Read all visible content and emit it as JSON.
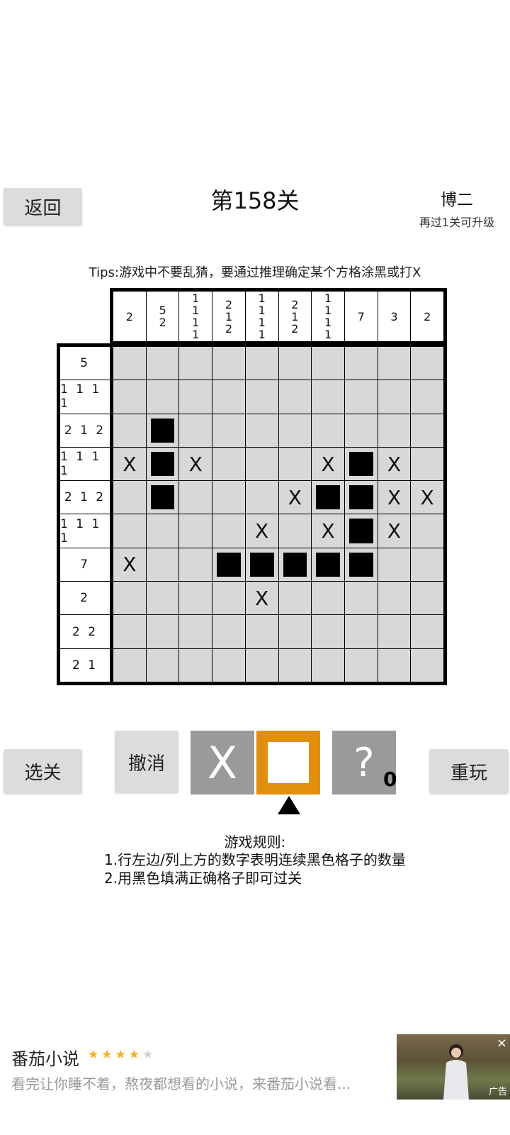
{
  "header": {
    "back_label": "返回",
    "level_title": "第158关",
    "rank_name": "博二",
    "rank_hint": "再过1关可升级"
  },
  "tips": "Tips:游戏中不要乱猜，要通过推理确定某个方格涂黑或打X",
  "puzzle": {
    "col_clues": [
      [
        "2"
      ],
      [
        "5",
        "2"
      ],
      [
        "1",
        "1",
        "1",
        "1"
      ],
      [
        "2",
        "1",
        "2"
      ],
      [
        "1",
        "1",
        "1",
        "1"
      ],
      [
        "2",
        "1",
        "2"
      ],
      [
        "1",
        "1",
        "1",
        "1"
      ],
      [
        "7"
      ],
      [
        "3"
      ],
      [
        "2"
      ]
    ],
    "row_clues": [
      "5",
      "1 1 1 1",
      "2 1 2",
      "1 1 1 1",
      "2 1 2",
      "1 1 1 1",
      "7",
      "2",
      "2 2",
      "2 1"
    ],
    "grid": [
      [
        "",
        "",
        "",
        "",
        "",
        "",
        "",
        "",
        "",
        ""
      ],
      [
        "",
        "",
        "",
        "",
        "",
        "",
        "",
        "",
        "",
        ""
      ],
      [
        "",
        "F",
        "",
        "",
        "",
        "",
        "",
        "",
        "",
        ""
      ],
      [
        "X",
        "F",
        "X",
        "",
        "",
        "",
        "X",
        "F",
        "X",
        ""
      ],
      [
        "",
        "F",
        "",
        "",
        "",
        "X",
        "F",
        "F",
        "X",
        "X"
      ],
      [
        "",
        "",
        "",
        "",
        "X",
        "",
        "X",
        "F",
        "X",
        ""
      ],
      [
        "X",
        "",
        "",
        "F",
        "F",
        "F",
        "F",
        "F",
        "",
        ""
      ],
      [
        "",
        "",
        "",
        "",
        "X",
        "",
        "",
        "",
        "",
        ""
      ],
      [
        "",
        "",
        "",
        "",
        "",
        "",
        "",
        "",
        "",
        ""
      ],
      [
        "",
        "",
        "",
        "",
        "",
        "",
        "",
        "",
        "",
        ""
      ]
    ]
  },
  "toolbar": {
    "select_level_label": "选关",
    "undo_label": "撤消",
    "mark_x_label": "X",
    "hint_label": "?",
    "hint_count": "0",
    "replay_label": "重玩",
    "selected_tool": "fill"
  },
  "rules": {
    "title": "游戏规则:",
    "line1": "1.行左边/列上方的数字表明连续黑色格子的数量",
    "line2": "2.用黑色填满正确格子即可过关"
  },
  "ad": {
    "title": "番茄小说",
    "rating": 4,
    "rating_max": 5,
    "description": "看完让你睡不着，熬夜都想看的小说，来番茄小说看...",
    "close_icon": "×",
    "tag": "广告"
  },
  "colors": {
    "cell": "#d8d8db",
    "filled": "#000000",
    "tool_active": "#e0900e",
    "tool_inactive": "#9a9a9a",
    "button": "#dcdcdc",
    "star": "#f5b026"
  }
}
